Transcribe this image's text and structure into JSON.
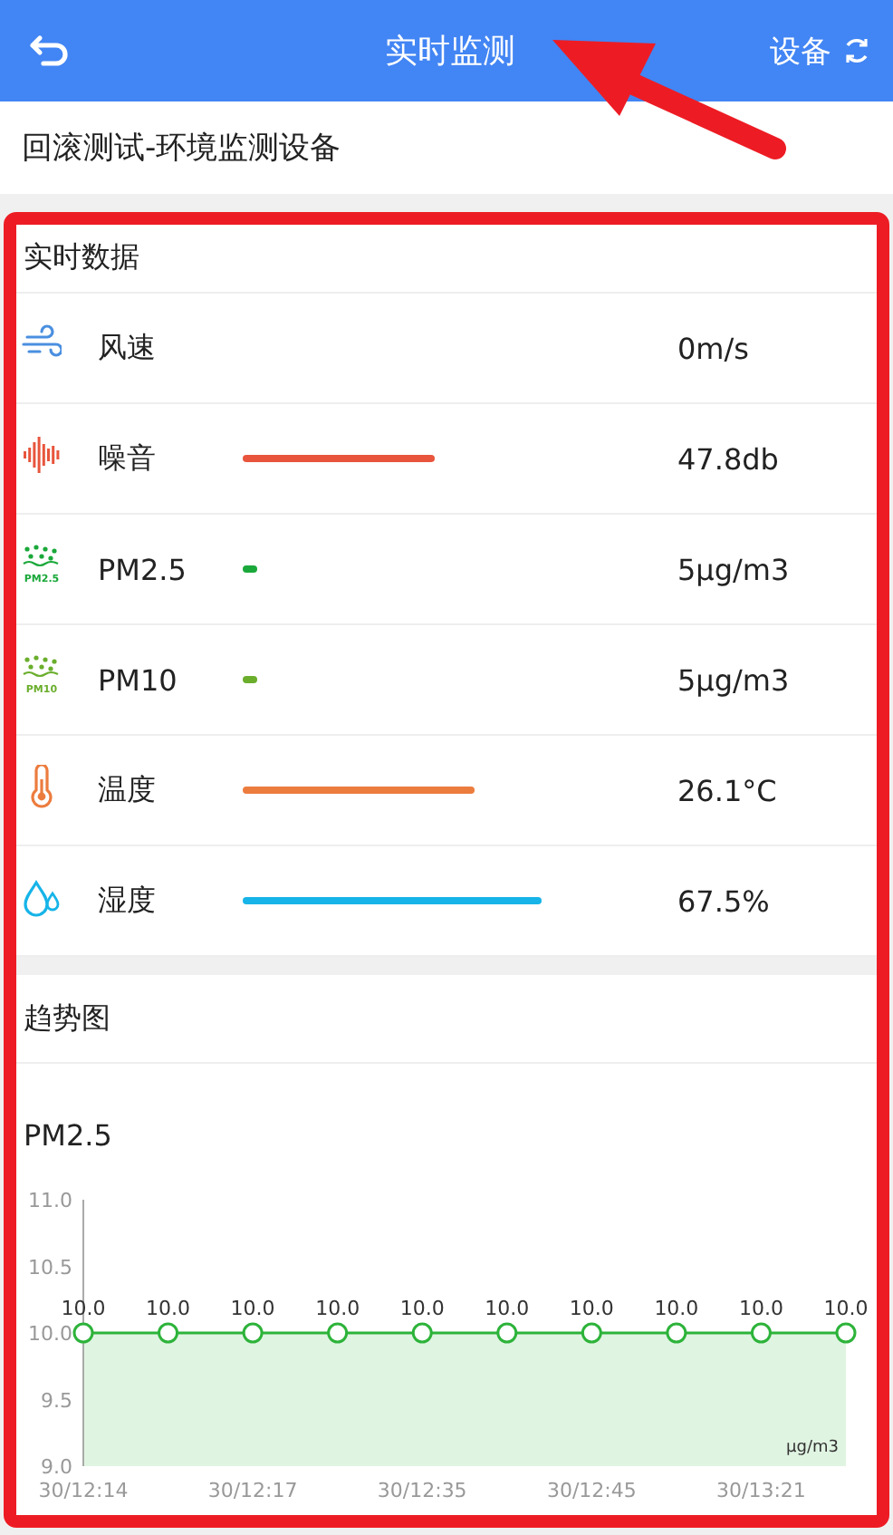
{
  "header": {
    "title": "实时监测",
    "action": "设备"
  },
  "device_name": "回滚测试-环境监测设备",
  "realtime": {
    "title": "实时数据",
    "metrics": [
      {
        "kind": "wind",
        "name": "风速",
        "value": "0m/s",
        "color": "#4a8fe0"
      },
      {
        "kind": "noise",
        "name": "噪音",
        "value": "47.8db",
        "color": "#e8553c"
      },
      {
        "kind": "dust",
        "name": "PM2.5",
        "icon_label": "PM2.5",
        "value": "5μg/m3",
        "color": "#1aa83a"
      },
      {
        "kind": "dust",
        "name": "PM10",
        "icon_label": "PM10",
        "value": "5μg/m3",
        "color": "#6aae2c"
      },
      {
        "kind": "temperature",
        "name": "温度",
        "value": "26.1°C",
        "color": "#ec7c3e"
      },
      {
        "kind": "humidity",
        "name": "湿度",
        "value": "67.5%",
        "color": "#16b4e8"
      }
    ]
  },
  "trend": {
    "title": "趋势图",
    "chart_data": {
      "type": "area",
      "title": "PM2.5",
      "categories": [
        "30/12:14",
        null,
        "30/12:17",
        null,
        "30/12:35",
        null,
        "30/12:45",
        null,
        "30/13:21",
        null
      ],
      "ylim": [
        9,
        11
      ],
      "yticks": [
        {
          "value": 9,
          "label": "9.0"
        },
        {
          "value": 9.5,
          "label": "9.5"
        },
        {
          "value": 10,
          "label": "10.0"
        },
        {
          "value": 10.5,
          "label": "10.5"
        },
        {
          "value": 11,
          "label": "11.0"
        }
      ],
      "series": [
        {
          "color": "#2db33a",
          "values": [
            10,
            10,
            10,
            10,
            10,
            10,
            10,
            10,
            10,
            10
          ]
        }
      ],
      "value_labels": [
        "10.0",
        "10.0",
        "10.0",
        "10.0",
        "10.0",
        "10.0",
        "10.0",
        "10.0",
        "10.0",
        "10.0"
      ],
      "annotations": [
        "μg/m3"
      ]
    }
  }
}
